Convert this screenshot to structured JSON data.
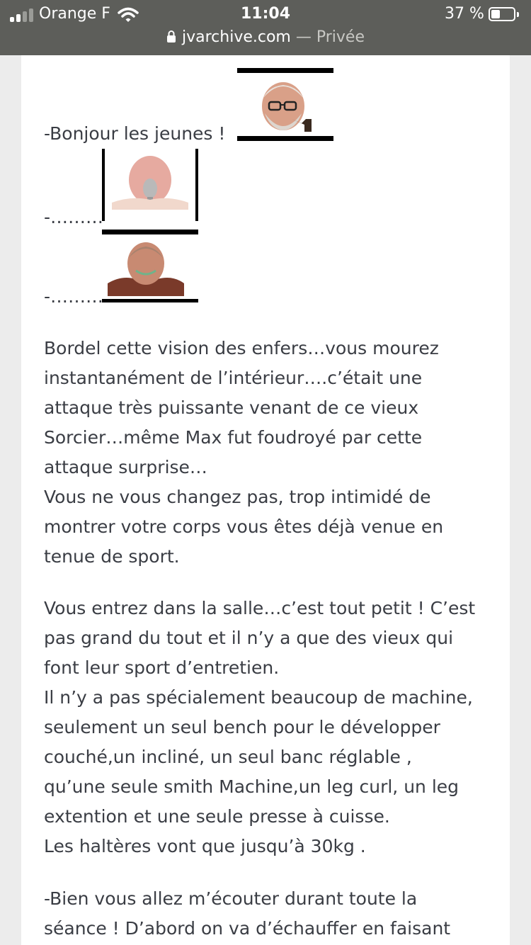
{
  "status_bar": {
    "carrier": "Orange F",
    "time": "11:04",
    "battery_percent": "37 %",
    "battery_level": 0.37,
    "signal_bars_active": 2,
    "signal_bars_total": 4
  },
  "url_bar": {
    "domain": "jvarchive.com",
    "mode": "— Privée"
  },
  "post": {
    "dialog": [
      {
        "text": "-Bonjour les jeunes !",
        "sticker": "old-man-with-pipe"
      },
      {
        "text": "-………",
        "sticker": "bald-man-with-microphone"
      },
      {
        "text": "-………",
        "sticker": "old-man-in-sweater"
      }
    ],
    "paragraph_1": [
      "Bordel cette vision des enfers…vous mourez",
      "instantanément de l’intérieur….c’était une",
      "attaque très puissante venant de ce vieux",
      "Sorcier…même Max fut foudroyé par cette",
      "attaque surprise…",
      "Vous ne vous changez pas, trop intimidé de",
      "montrer votre corps vous êtes déjà venue en",
      "tenue de sport."
    ],
    "paragraph_2": [
      "Vous entrez dans la salle…c’est tout petit ! C’est",
      "pas grand du tout et il n’y a que des vieux qui",
      "font leur sport d’entretien.",
      "Il n’y a pas spécialement beaucoup de machine,",
      "seulement un seul bench pour le développer",
      "couché,un incliné, un seul banc réglable ,",
      "qu’une seule smith Machine,un leg curl, un leg",
      "extention et une seule presse à cuisse.",
      "Les haltères vont que jusqu’à 30kg ."
    ],
    "paragraph_3": [
      "-Bien vous allez m’écouter durant toute la",
      "séance ! D’abord on va d’échauffer en faisant"
    ]
  },
  "colors": {
    "toolbar": "#5d5e5a",
    "text": "#3a3d44",
    "page_background": "#ececec",
    "card": "#ffffff"
  }
}
